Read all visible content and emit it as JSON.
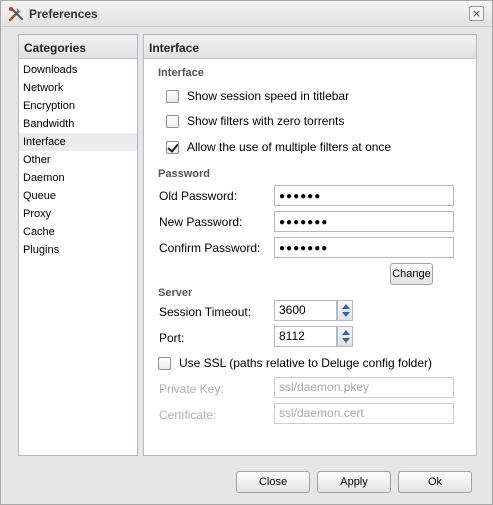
{
  "window": {
    "title": "Preferences",
    "close_glyph": "×"
  },
  "icons": {
    "title_icon": "tools-icon",
    "close_icon": "close-icon"
  },
  "categories": {
    "header": "Categories",
    "items": [
      "Downloads",
      "Network",
      "Encryption",
      "Bandwidth",
      "Interface",
      "Other",
      "Daemon",
      "Queue",
      "Proxy",
      "Cache",
      "Plugins"
    ],
    "selected": "Interface"
  },
  "main": {
    "header": "Interface",
    "interface_section": {
      "title": "Interface",
      "options": [
        {
          "label": "Show session speed in titlebar",
          "checked": false
        },
        {
          "label": "Show filters with zero torrents",
          "checked": false
        },
        {
          "label": "Allow the use of multiple filters at once",
          "checked": true
        }
      ]
    },
    "password_section": {
      "title": "Password",
      "old_label": "Old Password:",
      "old_value": "●●●●●●",
      "new_label": "New Password:",
      "new_value": "●●●●●●●",
      "confirm_label": "Confirm Password:",
      "confirm_value": "●●●●●●●",
      "change_button": "Change"
    },
    "server_section": {
      "title": "Server",
      "timeout_label": "Session Timeout:",
      "timeout_value": "3600",
      "port_label": "Port:",
      "port_value": "8112",
      "ssl_label": "Use SSL (paths relative to Deluge config folder)",
      "ssl_checked": false,
      "private_key_label": "Private Key:",
      "private_key_value": "ssl/daemon.pkey",
      "certificate_label": "Certificate:",
      "certificate_value": "ssl/daemon.cert"
    }
  },
  "footer": {
    "close_label": "Close",
    "apply_label": "Apply",
    "ok_label": "Ok"
  },
  "colors": {
    "spin_arrow": "#3465a4",
    "panel_border": "#b5b8c8",
    "selected_bg": "#ececec"
  }
}
